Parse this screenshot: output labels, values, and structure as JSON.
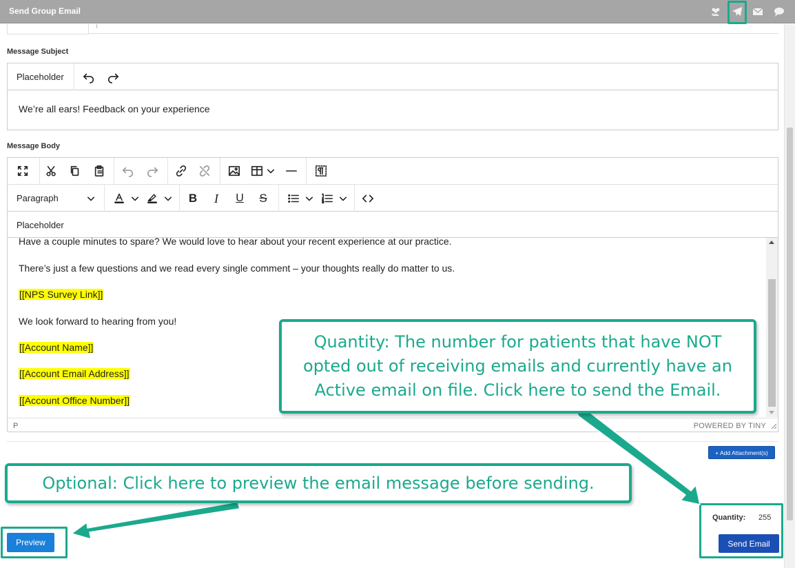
{
  "window": {
    "title": "Send Group Email"
  },
  "titlebar_icons": [
    "users-icon",
    "send-icon",
    "envelope-icon",
    "chat-icon"
  ],
  "subject": {
    "label": "Message Subject",
    "placeholder_button": "Placeholder",
    "value": "We’re all ears! Feedback on your experience"
  },
  "body": {
    "label": "Message Body",
    "block_format": "Paragraph",
    "placeholder_button": "Placeholder",
    "lines": [
      "Have a couple minutes to spare? We would love to hear about your recent experience at our practice.",
      "There’s just a few questions and we read every single comment – your thoughts really do matter to us.",
      "[[NPS Survey Link]]",
      "We look forward to hearing from you!",
      "[[Account Name]]",
      "[[Account Email Address]]",
      "[[Account Office Number]]"
    ],
    "status_path": "P",
    "powered_by": "POWERED BY TINY"
  },
  "attachment_button": "+ Add Attachment(s)",
  "quantity": {
    "label": "Quantity:",
    "value": "255"
  },
  "buttons": {
    "preview": "Preview",
    "send": "Send Email"
  },
  "callouts": {
    "quantity": "Quantity: The number for patients that have NOT opted out of receiving emails and currently have an Active email on file. Click here to send the Email.",
    "preview": "Optional: Click here to preview the email message before sending."
  },
  "colors": {
    "titlebar": "#a6a6a6",
    "callout_accent": "#1ba98d",
    "send_button": "#1b4fb4",
    "preview_button": "#1a80d9",
    "highlight": "#ffff00"
  }
}
